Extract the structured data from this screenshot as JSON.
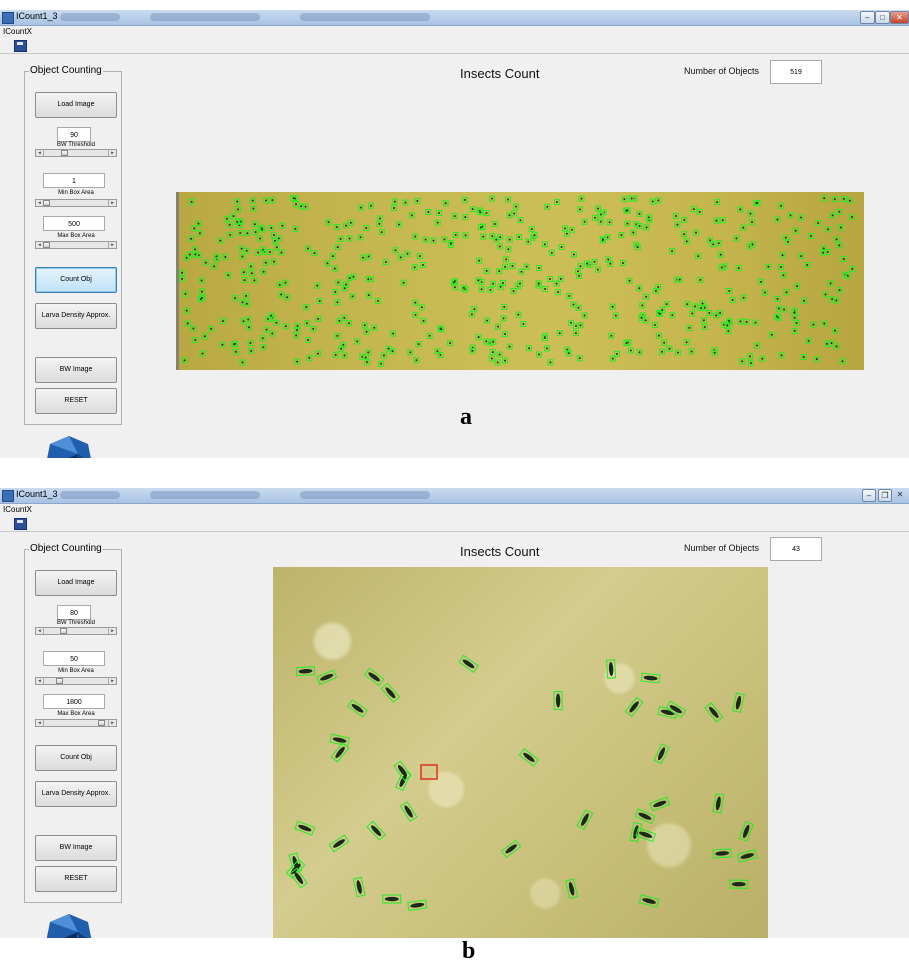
{
  "windows": [
    {
      "window_title": "ICount1_3",
      "menu_label": "ICountX",
      "panel_title": "Object Counting",
      "heading": "Insects Count",
      "number_label": "Number of Objects",
      "number_value": "519",
      "buttons": {
        "load_image": "Load Image",
        "count_obj": "Count Obj",
        "larva_density": "Larva Density Approx.",
        "bw_image": "BW Image",
        "reset": "RESET"
      },
      "controls": {
        "bw_threshold": {
          "value": "90",
          "label": "BW Threshold"
        },
        "min_box_area": {
          "value": "1",
          "label": "Min Box Area"
        },
        "max_box_area": {
          "value": "500",
          "label": "Max Box Area"
        }
      },
      "active_button": "count_obj",
      "caption": "a",
      "window_controls": [
        "minimize-icon",
        "maximize-icon",
        "close-icon"
      ]
    },
    {
      "window_title": "ICount1_3",
      "menu_label": "ICountX",
      "panel_title": "Object Counting",
      "heading": "Insects Count",
      "number_label": "Number of Objects",
      "number_value": "43",
      "buttons": {
        "load_image": "Load Image",
        "count_obj": "Count Obj",
        "larva_density": "Larva Density Approx.",
        "bw_image": "BW Image",
        "reset": "RESET"
      },
      "controls": {
        "bw_threshold": {
          "value": "80",
          "label": "BW Threshold"
        },
        "min_box_area": {
          "value": "50",
          "label": "Min Box Area"
        },
        "max_box_area": {
          "value": "1800",
          "label": "Max Box Area"
        }
      },
      "caption": "b",
      "window_controls": [
        "minimize-icon",
        "restore-icon",
        "close-icon"
      ]
    }
  ],
  "colors": {
    "detection_box": "#22ee22",
    "highlight_box": "#e03020",
    "insect": "#1a2a1a",
    "active_button_border": "#3c7fb1"
  }
}
